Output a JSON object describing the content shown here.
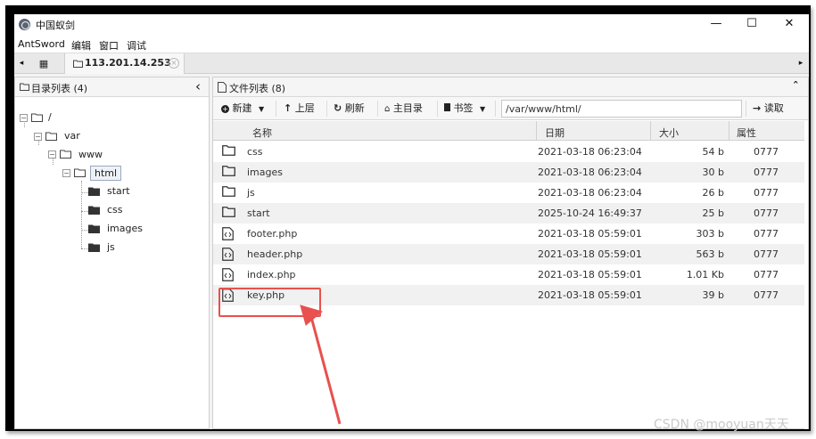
{
  "window": {
    "title": "中国蚁剑",
    "minimize": "—",
    "maximize": "☐",
    "close": "✕"
  },
  "menu": [
    "AntSword",
    "编辑",
    "窗口",
    "调试"
  ],
  "tabs": {
    "grid_icon": "▦",
    "active_label": "113.201.14.253",
    "close": "×",
    "left_arrow": "◂",
    "right_arrow": "▸"
  },
  "left_panel": {
    "title": "目录列表 (4)",
    "collapse": "‹",
    "tree": {
      "root": "/",
      "var": "var",
      "www": "www",
      "html": "html",
      "children": [
        "start",
        "css",
        "images",
        "js"
      ]
    }
  },
  "right_panel": {
    "title": "文件列表 (8)",
    "collapse": "ˆ",
    "toolbar": {
      "new": "新建",
      "up": "上层",
      "refresh": "刷新",
      "home": "主目录",
      "bookmark": "书签",
      "path": "/var/www/html/",
      "read": "读取"
    },
    "columns": {
      "name": "名称",
      "date": "日期",
      "size": "大小",
      "attr": "属性"
    },
    "files": [
      {
        "type": "folder",
        "name": "css",
        "date": "2021-03-18 06:23:04",
        "size": "54 b",
        "attr": "0777"
      },
      {
        "type": "folder",
        "name": "images",
        "date": "2021-03-18 06:23:04",
        "size": "30 b",
        "attr": "0777"
      },
      {
        "type": "folder",
        "name": "js",
        "date": "2021-03-18 06:23:04",
        "size": "26 b",
        "attr": "0777"
      },
      {
        "type": "folder",
        "name": "start",
        "date": "2025-10-24 16:49:37",
        "size": "25 b",
        "attr": "0777"
      },
      {
        "type": "file",
        "name": "footer.php",
        "date": "2021-03-18 05:59:01",
        "size": "303 b",
        "attr": "0777"
      },
      {
        "type": "file",
        "name": "header.php",
        "date": "2021-03-18 05:59:01",
        "size": "563 b",
        "attr": "0777"
      },
      {
        "type": "file",
        "name": "index.php",
        "date": "2021-03-18 05:59:01",
        "size": "1.01 Kb",
        "attr": "0777"
      },
      {
        "type": "file",
        "name": "key.php",
        "date": "2021-03-18 05:59:01",
        "size": "39 b",
        "attr": "0777"
      }
    ]
  },
  "watermark": "CSDN @mooyuan天天",
  "colors": {
    "annotation": "#e8514d",
    "row_alt": "#f1f1f1"
  }
}
